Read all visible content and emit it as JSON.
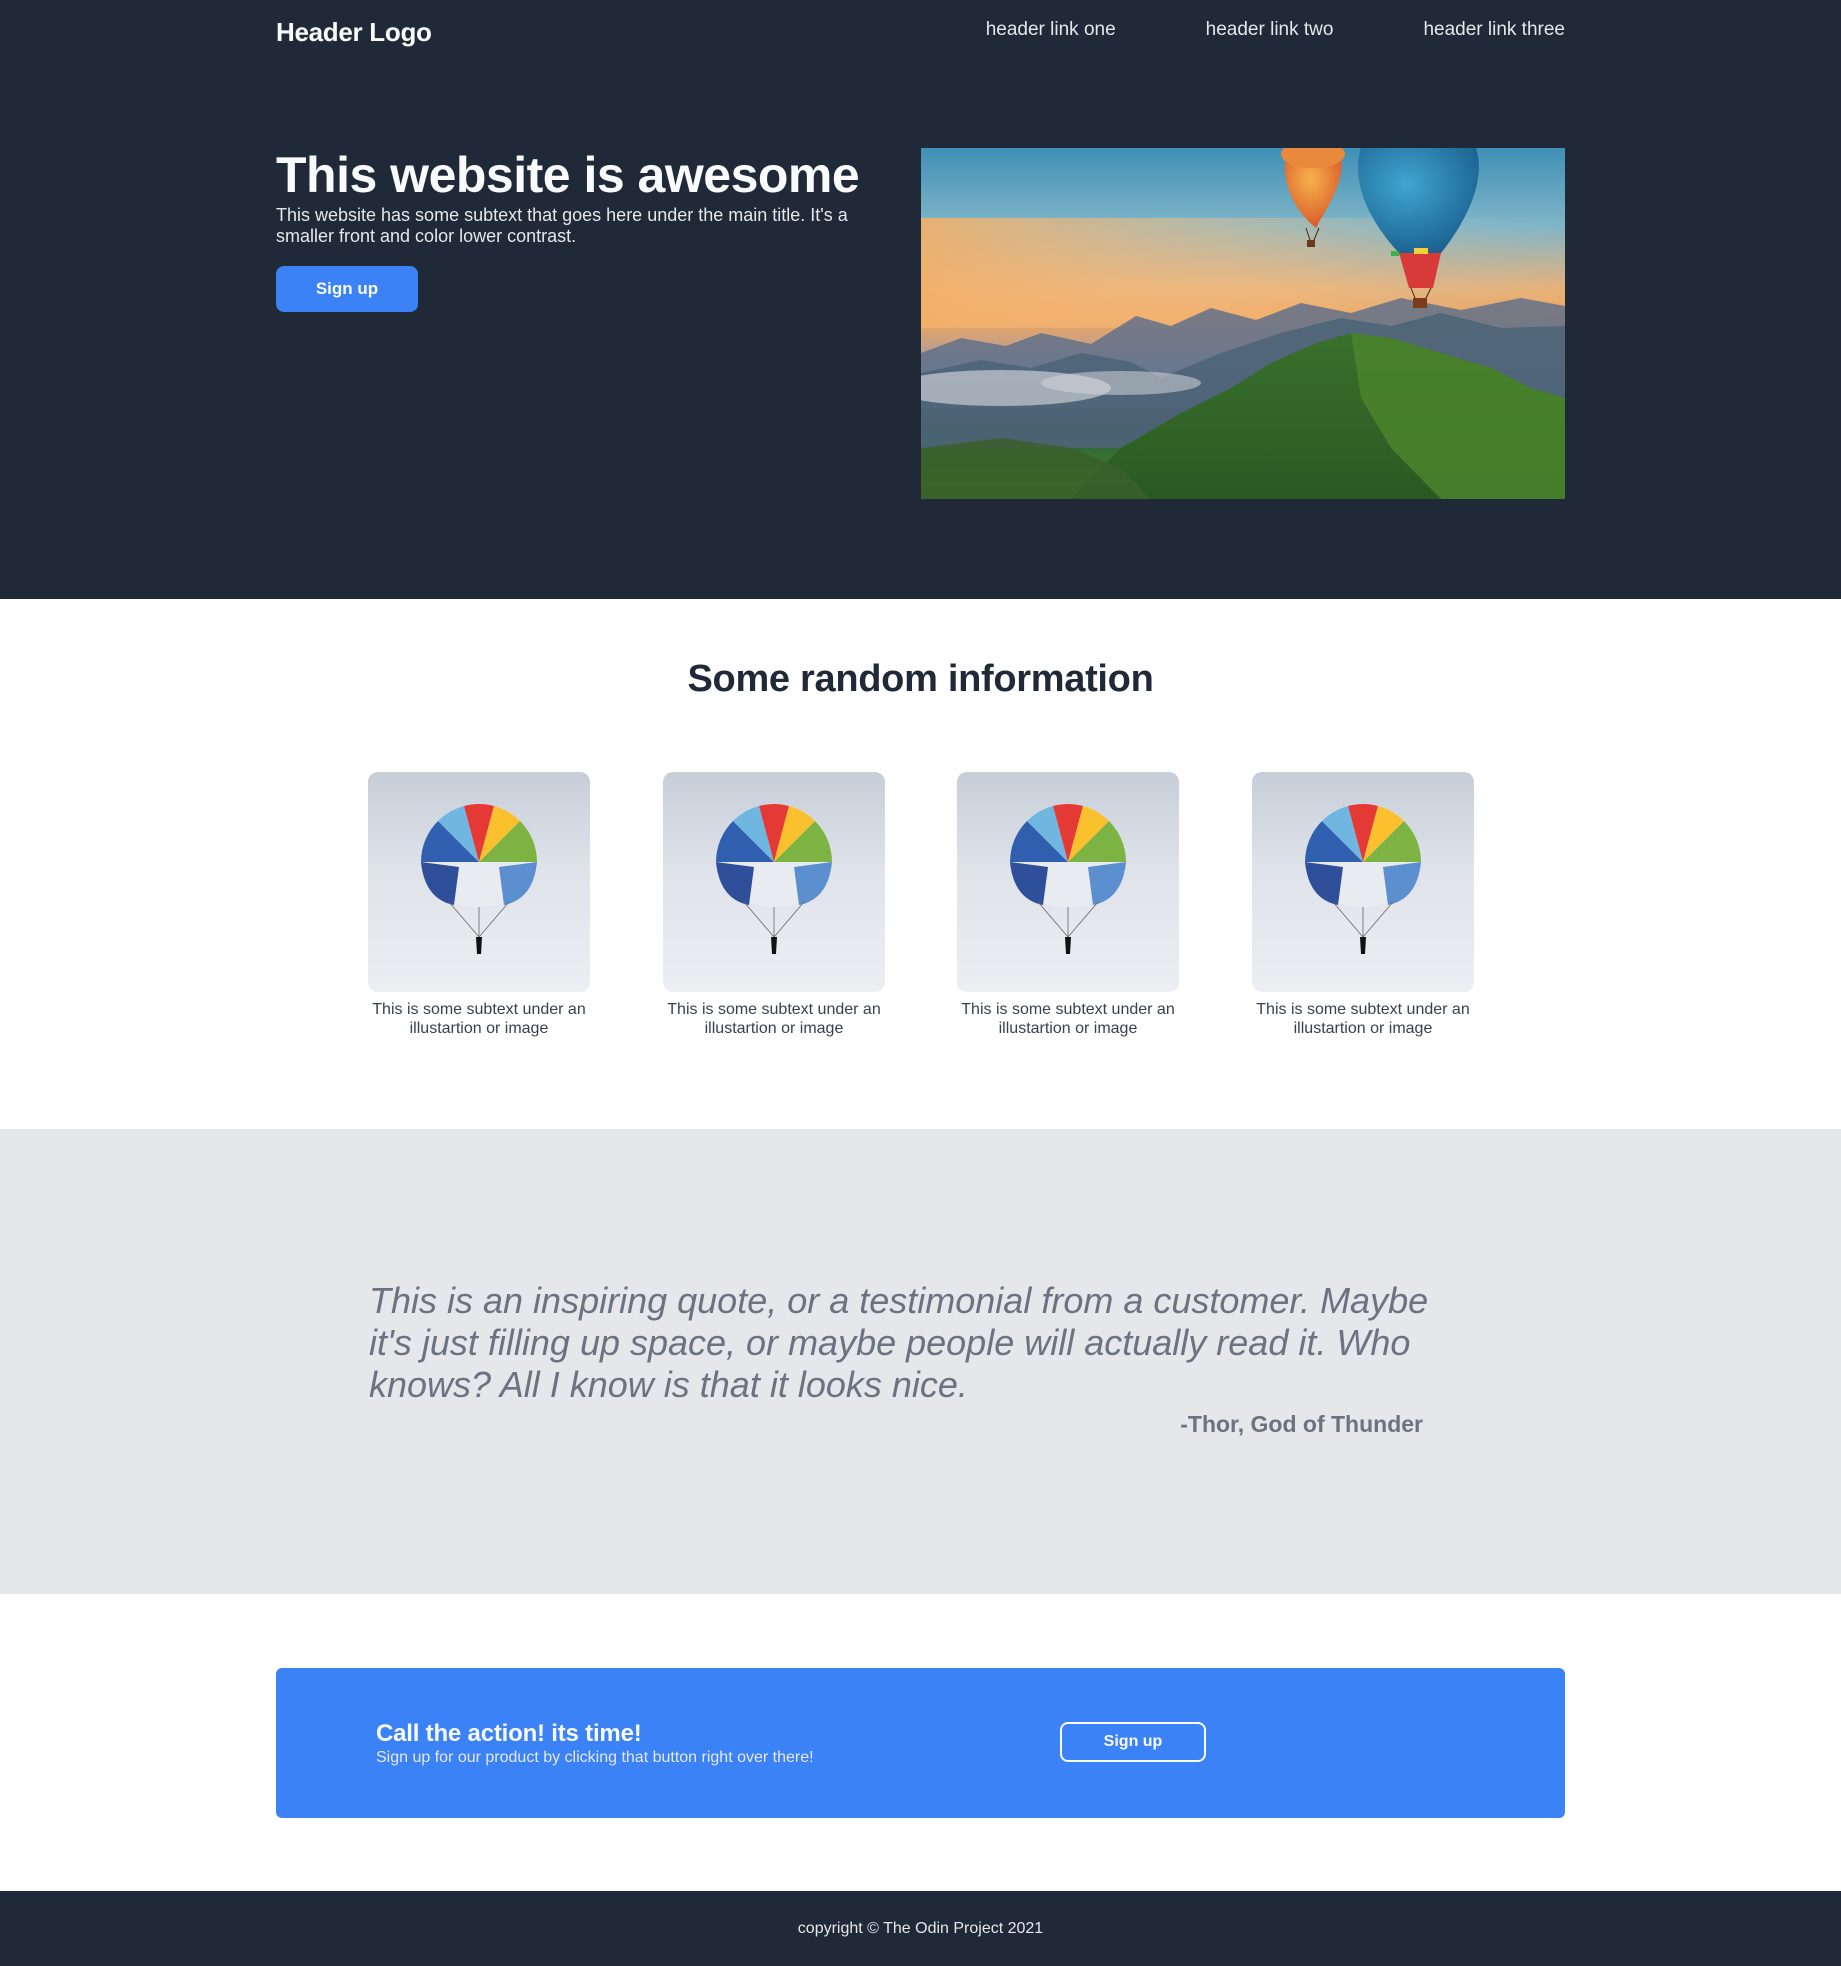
{
  "header": {
    "logo": "Header Logo",
    "links": [
      "header link one",
      "header link two",
      "header link three"
    ]
  },
  "hero": {
    "title": "This website is awesome",
    "subtext": "This website has some subtext that goes here under the main title. It's a smaller front and color lower contrast.",
    "button_label": "Sign up",
    "image": "hot-air-balloons-over-mountains"
  },
  "info": {
    "title": "Some random information",
    "cards": [
      {
        "image": "parachute-icon",
        "caption": "This is some subtext under an illustartion or image"
      },
      {
        "image": "parachute-icon",
        "caption": "This is some subtext under an illustartion or image"
      },
      {
        "image": "parachute-icon",
        "caption": "This is some subtext under an illustartion or image"
      },
      {
        "image": "parachute-icon",
        "caption": "This is some subtext under an illustartion or image"
      }
    ]
  },
  "quote": {
    "text": "This is an inspiring quote, or a testimonial from a customer. Maybe it's just filling up space, or maybe people will actually read it. Who knows? All I know is that it looks nice.",
    "author": "-Thor, God of Thunder"
  },
  "cta": {
    "title": "Call the action! its time!",
    "subtext": "Sign up for our product by clicking that button right over there!",
    "button_label": "Sign up"
  },
  "footer": {
    "text": "copyright © The Odin Project 2021"
  },
  "colors": {
    "dark": "#1f2937",
    "accent": "#3b82f6",
    "band": "#e5e7eb",
    "muted": "#6b7280"
  }
}
